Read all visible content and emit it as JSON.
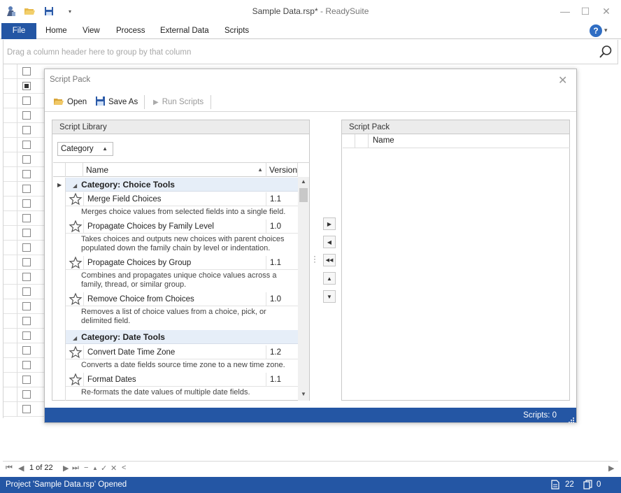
{
  "window": {
    "title": "Sample Data.rsp*",
    "title_sep": " - ",
    "app_name": "ReadySuite",
    "min_glyph": "—",
    "max_glyph": "☐",
    "close_glyph": "✕"
  },
  "quick_access": [
    "app-logo-icon",
    "open-folder-icon",
    "save-icon",
    "customize-dropdown-icon"
  ],
  "ribbon": {
    "tabs": [
      "File",
      "Home",
      "View",
      "Process",
      "External Data",
      "Scripts"
    ],
    "help_label": "?"
  },
  "group_panel": {
    "placeholder": "Drag a column header here to group by that column"
  },
  "navigator": {
    "page": "1 of 22",
    "first": "⏮",
    "prev": "◀",
    "next": "▶",
    "last": "⏭",
    "add": "+",
    "remove": "−",
    "edit": "▲",
    "save": "✓",
    "cancel": "✕",
    "refresh": "<"
  },
  "status": {
    "message": "Project 'Sample Data.rsp' Opened",
    "docs_count": "22",
    "pages_count": "0"
  },
  "dialog": {
    "title": "Script Pack",
    "close": "✕",
    "toolbar": {
      "open": "Open",
      "save_as": "Save As",
      "run_scripts": "Run Scripts"
    },
    "library": {
      "header": "Script Library",
      "group_by": "Category",
      "col_name": "Name",
      "col_version": "Version",
      "groups": [
        {
          "label": "Category: Choice Tools",
          "items": [
            {
              "name": "Merge Field Choices",
              "version": "1.1",
              "desc": "Merges choice values from selected fields into a single field."
            },
            {
              "name": "Propagate Choices by Family Level",
              "version": "1.0",
              "desc": "Takes choices and outputs new choices with parent choices populated down the family chain by level or indentation."
            },
            {
              "name": "Propagate Choices by Group",
              "version": "1.1",
              "desc": "Combines and propagates unique choice values across a family, thread, or similar group."
            },
            {
              "name": "Remove Choice from Choices",
              "version": "1.0",
              "desc": "Removes a list of choice values from a choice, pick, or delimited field."
            }
          ]
        },
        {
          "label": "Category: Date Tools",
          "items": [
            {
              "name": "Convert Date Time Zone",
              "version": "1.2",
              "desc": "Converts a date fields source time zone to a new time zone."
            },
            {
              "name": "Format Dates",
              "version": "1.1",
              "desc": "Re-formats the date values of multiple date fields."
            }
          ]
        }
      ]
    },
    "pack": {
      "header": "Script Pack",
      "col_name": "Name"
    },
    "move_buttons": [
      "▶",
      "◀",
      "◀◀",
      "▲",
      "▼"
    ],
    "footer": "Scripts: 0"
  },
  "colors": {
    "accent": "#2456a4",
    "group_row": "#e6eef8"
  }
}
